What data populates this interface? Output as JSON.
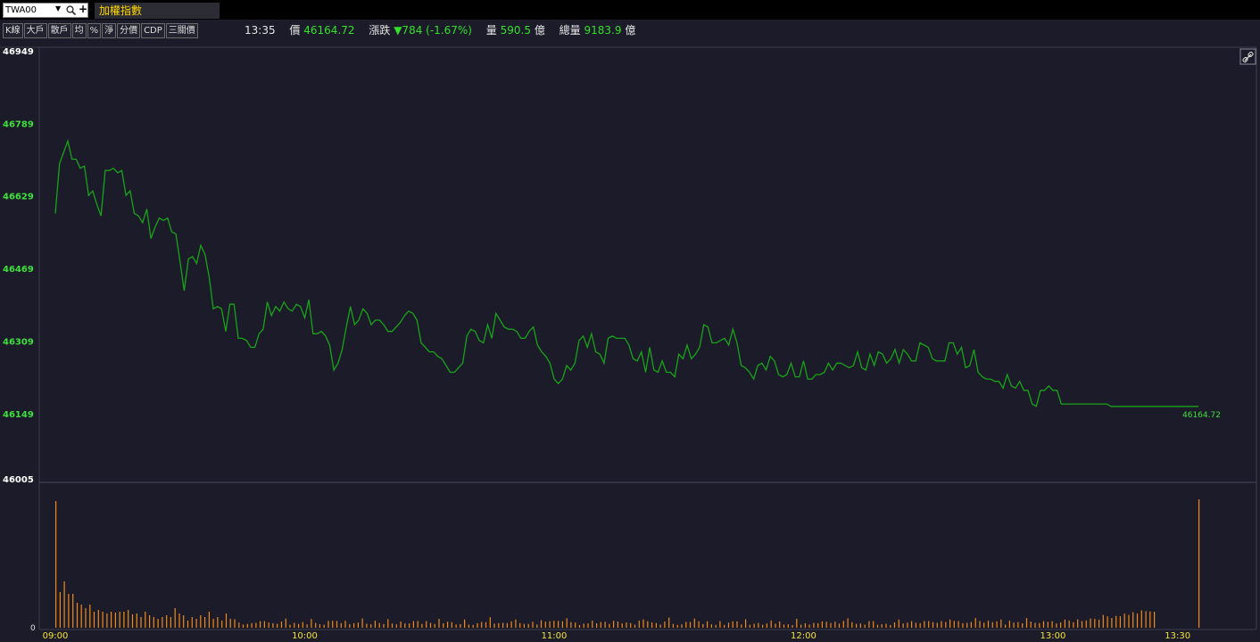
{
  "symbol": {
    "value": "TWA00",
    "name": "加權指數"
  },
  "toolbar": {
    "buttons": [
      "K線",
      "大戶",
      "散戶",
      "均",
      "%",
      "淨",
      "分價",
      "CDP",
      "三關價"
    ]
  },
  "quote": {
    "time": "13:35",
    "price_label": "價",
    "price": "46164.72",
    "change_label": "漲跌",
    "change": "▼784 (-1.67%)",
    "volume_label": "量",
    "volume": "590.5",
    "volume_unit": "億",
    "total_label": "總量",
    "total": "9183.9",
    "total_unit": "億"
  },
  "colors": {
    "price_line": "#19a319",
    "volume_bar": "#f08a1a",
    "axis_label": "#3de03d",
    "time_label": "#f5e43a",
    "background": "#1c1b29"
  },
  "icons": {
    "link": "link-icon"
  },
  "chart_data": {
    "type": "line",
    "price_axis": {
      "ticks": [
        "46949",
        "46789",
        "46629",
        "46469",
        "46309",
        "46149",
        "46005"
      ],
      "ylim": [
        46005,
        46949
      ]
    },
    "time_axis": {
      "ticks": [
        "09:00",
        "10:00",
        "11:00",
        "12:00",
        "13:00",
        "13:30"
      ],
      "xlim": [
        "09:00",
        "13:35"
      ]
    },
    "last_label": "46164.72",
    "price_series": [
      [
        "09:00",
        46590
      ],
      [
        "09:01",
        46700
      ],
      [
        "09:02",
        46725
      ],
      [
        "09:03",
        46750
      ],
      [
        "09:04",
        46710
      ],
      [
        "09:05",
        46710
      ],
      [
        "09:06",
        46690
      ],
      [
        "09:07",
        46695
      ],
      [
        "09:08",
        46630
      ],
      [
        "09:09",
        46640
      ],
      [
        "09:10",
        46610
      ],
      [
        "09:11",
        46585
      ],
      [
        "09:12",
        46685
      ],
      [
        "09:13",
        46685
      ],
      [
        "09:14",
        46690
      ],
      [
        "09:15",
        46680
      ],
      [
        "09:16",
        46685
      ],
      [
        "09:17",
        46630
      ],
      [
        "09:18",
        46640
      ],
      [
        "09:19",
        46590
      ],
      [
        "09:20",
        46585
      ],
      [
        "09:21",
        46570
      ],
      [
        "09:22",
        46600
      ],
      [
        "09:23",
        46535
      ],
      [
        "09:24",
        46560
      ],
      [
        "09:25",
        46580
      ],
      [
        "09:26",
        46575
      ],
      [
        "09:27",
        46580
      ],
      [
        "09:28",
        46550
      ],
      [
        "09:29",
        46545
      ],
      [
        "09:30",
        46485
      ],
      [
        "09:31",
        46420
      ],
      [
        "09:32",
        46490
      ],
      [
        "09:33",
        46495
      ],
      [
        "09:34",
        46480
      ],
      [
        "09:35",
        46520
      ],
      [
        "09:36",
        46500
      ],
      [
        "09:37",
        46450
      ],
      [
        "09:38",
        46380
      ],
      [
        "09:39",
        46385
      ],
      [
        "09:40",
        46380
      ],
      [
        "09:41",
        46330
      ],
      [
        "09:42",
        46390
      ],
      [
        "09:43",
        46390
      ],
      [
        "09:44",
        46315
      ],
      [
        "09:45",
        46315
      ],
      [
        "09:46",
        46310
      ],
      [
        "09:47",
        46295
      ],
      [
        "09:48",
        46295
      ],
      [
        "09:49",
        46325
      ],
      [
        "09:50",
        46335
      ],
      [
        "09:51",
        46395
      ],
      [
        "09:52",
        46365
      ],
      [
        "09:53",
        46385
      ],
      [
        "09:54",
        46375
      ],
      [
        "09:55",
        46395
      ],
      [
        "09:56",
        46380
      ],
      [
        "09:57",
        46375
      ],
      [
        "09:58",
        46390
      ],
      [
        "09:59",
        46385
      ],
      [
        "10:00",
        46360
      ],
      [
        "10:01",
        46400
      ],
      [
        "10:02",
        46325
      ],
      [
        "10:03",
        46325
      ],
      [
        "10:04",
        46330
      ],
      [
        "10:05",
        46320
      ],
      [
        "10:06",
        46300
      ],
      [
        "10:07",
        46245
      ],
      [
        "10:08",
        46260
      ],
      [
        "10:09",
        46290
      ],
      [
        "10:10",
        46340
      ],
      [
        "10:11",
        46385
      ],
      [
        "10:12",
        46345
      ],
      [
        "10:13",
        46355
      ],
      [
        "10:14",
        46380
      ],
      [
        "10:15",
        46370
      ],
      [
        "10:16",
        46345
      ],
      [
        "10:17",
        46355
      ],
      [
        "10:18",
        46355
      ],
      [
        "10:19",
        46345
      ],
      [
        "10:20",
        46330
      ],
      [
        "10:21",
        46330
      ],
      [
        "10:22",
        46340
      ],
      [
        "10:23",
        46350
      ],
      [
        "10:24",
        46365
      ],
      [
        "10:25",
        46375
      ],
      [
        "10:26",
        46370
      ],
      [
        "10:27",
        46355
      ],
      [
        "10:28",
        46305
      ],
      [
        "10:29",
        46295
      ],
      [
        "10:30",
        46285
      ],
      [
        "10:31",
        46285
      ],
      [
        "10:32",
        46275
      ],
      [
        "10:33",
        46270
      ],
      [
        "10:34",
        46255
      ],
      [
        "10:35",
        46240
      ],
      [
        "10:36",
        46240
      ],
      [
        "10:37",
        46250
      ],
      [
        "10:38",
        46260
      ],
      [
        "10:39",
        46320
      ],
      [
        "10:40",
        46335
      ],
      [
        "10:41",
        46330
      ],
      [
        "10:42",
        46310
      ],
      [
        "10:43",
        46305
      ],
      [
        "10:44",
        46345
      ],
      [
        "10:45",
        46315
      ],
      [
        "10:46",
        46370
      ],
      [
        "10:47",
        46355
      ],
      [
        "10:48",
        46340
      ],
      [
        "10:49",
        46335
      ],
      [
        "10:50",
        46335
      ],
      [
        "10:51",
        46330
      ],
      [
        "10:52",
        46315
      ],
      [
        "10:53",
        46315
      ],
      [
        "10:54",
        46330
      ],
      [
        "10:55",
        46340
      ],
      [
        "10:56",
        46300
      ],
      [
        "10:57",
        46285
      ],
      [
        "10:58",
        46275
      ],
      [
        "10:59",
        46260
      ],
      [
        "11:00",
        46225
      ],
      [
        "11:01",
        46215
      ],
      [
        "11:02",
        46225
      ],
      [
        "11:03",
        46255
      ],
      [
        "11:04",
        46245
      ],
      [
        "11:05",
        46260
      ],
      [
        "11:06",
        46310
      ],
      [
        "11:07",
        46320
      ],
      [
        "11:08",
        46295
      ],
      [
        "11:09",
        46325
      ],
      [
        "11:10",
        46285
      ],
      [
        "11:11",
        46280
      ],
      [
        "11:12",
        46260
      ],
      [
        "11:13",
        46315
      ],
      [
        "11:14",
        46320
      ],
      [
        "11:15",
        46315
      ],
      [
        "11:16",
        46315
      ],
      [
        "11:17",
        46315
      ],
      [
        "11:18",
        46300
      ],
      [
        "11:19",
        46270
      ],
      [
        "11:20",
        46265
      ],
      [
        "11:21",
        46285
      ],
      [
        "11:22",
        46240
      ],
      [
        "11:23",
        46295
      ],
      [
        "11:24",
        46245
      ],
      [
        "11:25",
        46240
      ],
      [
        "11:26",
        46265
      ],
      [
        "11:27",
        46240
      ],
      [
        "11:28",
        46240
      ],
      [
        "11:29",
        46230
      ],
      [
        "11:30",
        46280
      ],
      [
        "11:31",
        46270
      ],
      [
        "11:32",
        46300
      ],
      [
        "11:33",
        46270
      ],
      [
        "11:34",
        46280
      ],
      [
        "11:35",
        46295
      ],
      [
        "11:36",
        46345
      ],
      [
        "11:37",
        46340
      ],
      [
        "11:38",
        46305
      ],
      [
        "11:39",
        46305
      ],
      [
        "11:40",
        46310
      ],
      [
        "11:41",
        46315
      ],
      [
        "11:42",
        46300
      ],
      [
        "11:43",
        46335
      ],
      [
        "11:44",
        46305
      ],
      [
        "11:45",
        46255
      ],
      [
        "11:46",
        46250
      ],
      [
        "11:47",
        46240
      ],
      [
        "11:48",
        46225
      ],
      [
        "11:49",
        46255
      ],
      [
        "11:50",
        46260
      ],
      [
        "11:51",
        46245
      ],
      [
        "11:52",
        46275
      ],
      [
        "11:53",
        46265
      ],
      [
        "11:54",
        46235
      ],
      [
        "11:55",
        46230
      ],
      [
        "11:56",
        46235
      ],
      [
        "11:57",
        46260
      ],
      [
        "11:58",
        46230
      ],
      [
        "11:59",
        46230
      ],
      [
        "12:00",
        46265
      ],
      [
        "12:01",
        46225
      ],
      [
        "12:02",
        46225
      ],
      [
        "12:03",
        46235
      ],
      [
        "12:04",
        46235
      ],
      [
        "12:05",
        46240
      ],
      [
        "12:06",
        46260
      ],
      [
        "12:07",
        46245
      ],
      [
        "12:08",
        46260
      ],
      [
        "12:09",
        46260
      ],
      [
        "12:10",
        46255
      ],
      [
        "12:11",
        46250
      ],
      [
        "12:12",
        46255
      ],
      [
        "12:13",
        46285
      ],
      [
        "12:14",
        46250
      ],
      [
        "12:15",
        46245
      ],
      [
        "12:16",
        46280
      ],
      [
        "12:17",
        46255
      ],
      [
        "12:18",
        46285
      ],
      [
        "12:19",
        46280
      ],
      [
        "12:20",
        46260
      ],
      [
        "12:21",
        46270
      ],
      [
        "12:22",
        46290
      ],
      [
        "12:23",
        46260
      ],
      [
        "12:24",
        46290
      ],
      [
        "12:25",
        46280
      ],
      [
        "12:26",
        46265
      ],
      [
        "12:27",
        46265
      ],
      [
        "12:28",
        46305
      ],
      [
        "12:29",
        46300
      ],
      [
        "12:30",
        46295
      ],
      [
        "12:31",
        46270
      ],
      [
        "12:32",
        46265
      ],
      [
        "12:33",
        46265
      ],
      [
        "12:34",
        46265
      ],
      [
        "12:35",
        46305
      ],
      [
        "12:36",
        46305
      ],
      [
        "12:37",
        46280
      ],
      [
        "12:38",
        46295
      ],
      [
        "12:39",
        46250
      ],
      [
        "12:40",
        46255
      ],
      [
        "12:41",
        46290
      ],
      [
        "12:42",
        46240
      ],
      [
        "12:43",
        46230
      ],
      [
        "12:44",
        46225
      ],
      [
        "12:45",
        46225
      ],
      [
        "12:46",
        46220
      ],
      [
        "12:47",
        46220
      ],
      [
        "12:48",
        46205
      ],
      [
        "12:49",
        46235
      ],
      [
        "12:50",
        46210
      ],
      [
        "12:51",
        46205
      ],
      [
        "12:52",
        46220
      ],
      [
        "12:53",
        46200
      ],
      [
        "12:54",
        46200
      ],
      [
        "12:55",
        46170
      ],
      [
        "12:56",
        46165
      ],
      [
        "12:57",
        46200
      ],
      [
        "12:58",
        46200
      ],
      [
        "12:59",
        46210
      ],
      [
        "13:00",
        46200
      ],
      [
        "13:01",
        46200
      ],
      [
        "13:02",
        46170
      ],
      [
        "13:03",
        46170
      ],
      [
        "13:04",
        46170
      ],
      [
        "13:05",
        46170
      ],
      [
        "13:06",
        46170
      ],
      [
        "13:07",
        46170
      ],
      [
        "13:08",
        46170
      ],
      [
        "13:09",
        46170
      ],
      [
        "13:10",
        46170
      ],
      [
        "13:11",
        46170
      ],
      [
        "13:12",
        46170
      ],
      [
        "13:13",
        46170
      ],
      [
        "13:14",
        46164.72
      ]
    ],
    "volume_axis": {
      "ticks": [
        "0"
      ]
    },
    "volume_series": "per-minute traded volume bars (relative heights)"
  }
}
